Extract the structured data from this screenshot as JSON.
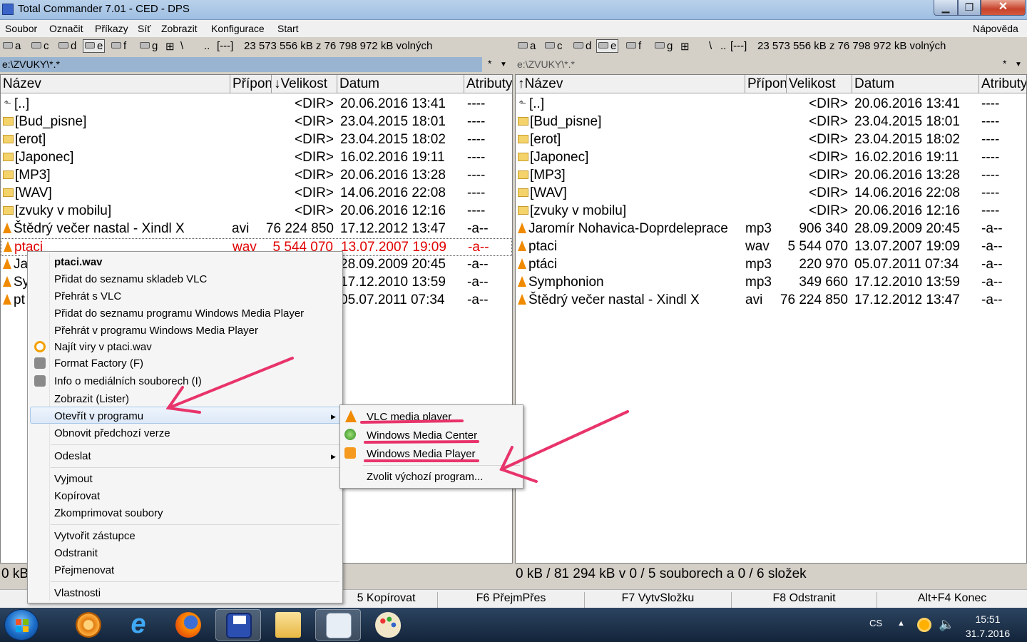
{
  "window": {
    "title": "Total Commander 7.01 - CED - DPS"
  },
  "menu": {
    "items": [
      "Soubor",
      "Označit",
      "Příkazy",
      "Síť",
      "Zobrazit",
      "Konfigurace",
      "Start"
    ],
    "help": "Nápověda"
  },
  "drives": {
    "items": [
      "a",
      "c",
      "d",
      "e",
      "f",
      "g"
    ],
    "root": "\\",
    "up": "..",
    "label": "[---]",
    "free": "23 573 556 kB z 76 798 972 kB volných"
  },
  "left_panel": {
    "path": "e:\\ZVUKY\\*.*",
    "filter": "*",
    "headers": {
      "name": "Název",
      "ext": "Přípon",
      "size": "Velikost",
      "date": "Datum",
      "attr": "Atributy"
    },
    "rows": [
      {
        "name": "[..]",
        "ext": "",
        "size": "<DIR>",
        "date": "20.06.2016 13:41",
        "attr": "----"
      },
      {
        "name": "[Bud_pisne]",
        "ext": "",
        "size": "<DIR>",
        "date": "23.04.2015 18:01",
        "attr": "----"
      },
      {
        "name": "[erot]",
        "ext": "",
        "size": "<DIR>",
        "date": "23.04.2015 18:02",
        "attr": "----"
      },
      {
        "name": "[Japonec]",
        "ext": "",
        "size": "<DIR>",
        "date": "16.02.2016 19:11",
        "attr": "----"
      },
      {
        "name": "[MP3]",
        "ext": "",
        "size": "<DIR>",
        "date": "20.06.2016 13:28",
        "attr": "----"
      },
      {
        "name": "[WAV]",
        "ext": "",
        "size": "<DIR>",
        "date": "14.06.2016 22:08",
        "attr": "----"
      },
      {
        "name": "[zvuky v mobilu]",
        "ext": "",
        "size": "<DIR>",
        "date": "20.06.2016 12:16",
        "attr": "----"
      },
      {
        "name": "Štědrý večer nastal - Xindl X",
        "ext": "avi",
        "size": "76 224 850",
        "date": "17.12.2012 13:47",
        "attr": "-a--"
      },
      {
        "name": "ptaci",
        "ext": "wav",
        "size": "5 544 070",
        "date": "13.07.2007 19:09",
        "attr": "-a--"
      },
      {
        "name": "Ja",
        "ext": "",
        "size": "",
        "date": "28.09.2009 20:45",
        "attr": "-a--"
      },
      {
        "name": "Sy",
        "ext": "",
        "size": "",
        "date": "17.12.2010 13:59",
        "attr": "-a--"
      },
      {
        "name": "pt",
        "ext": "",
        "size": "",
        "date": "05.07.2011 07:34",
        "attr": "-a--"
      }
    ],
    "status": "0 kB"
  },
  "right_panel": {
    "path": "e:\\ZVUKY\\*.*",
    "filter": "*",
    "headers": {
      "name": "Název",
      "ext": "Přípon",
      "size": "Velikost",
      "date": "Datum",
      "attr": "Atributy"
    },
    "rows": [
      {
        "name": "[..]",
        "ext": "",
        "size": "<DIR>",
        "date": "20.06.2016 13:41",
        "attr": "----"
      },
      {
        "name": "[Bud_pisne]",
        "ext": "",
        "size": "<DIR>",
        "date": "23.04.2015 18:01",
        "attr": "----"
      },
      {
        "name": "[erot]",
        "ext": "",
        "size": "<DIR>",
        "date": "23.04.2015 18:02",
        "attr": "----"
      },
      {
        "name": "[Japonec]",
        "ext": "",
        "size": "<DIR>",
        "date": "16.02.2016 19:11",
        "attr": "----"
      },
      {
        "name": "[MP3]",
        "ext": "",
        "size": "<DIR>",
        "date": "20.06.2016 13:28",
        "attr": "----"
      },
      {
        "name": "[WAV]",
        "ext": "",
        "size": "<DIR>",
        "date": "14.06.2016 22:08",
        "attr": "----"
      },
      {
        "name": "[zvuky v mobilu]",
        "ext": "",
        "size": "<DIR>",
        "date": "20.06.2016 12:16",
        "attr": "----"
      },
      {
        "name": "Jaromír Nohavica-Doprdeleprace",
        "ext": "mp3",
        "size": "906 340",
        "date": "28.09.2009 20:45",
        "attr": "-a--"
      },
      {
        "name": "ptaci",
        "ext": "wav",
        "size": "5 544 070",
        "date": "13.07.2007 19:09",
        "attr": "-a--"
      },
      {
        "name": "ptáci",
        "ext": "mp3",
        "size": "220 970",
        "date": "05.07.2011 07:34",
        "attr": "-a--"
      },
      {
        "name": "Symphonion",
        "ext": "mp3",
        "size": "349 660",
        "date": "17.12.2010 13:59",
        "attr": "-a--"
      },
      {
        "name": "Štědrý večer nastal - Xindl X",
        "ext": "avi",
        "size": "76 224 850",
        "date": "17.12.2012 13:47",
        "attr": "-a--"
      }
    ],
    "status": "0 kB / 81 294 kB v 0 / 5 souborech a 0 / 6 složek"
  },
  "fkeys": [
    "5 Kopírovat",
    "F6 PřejmPřes",
    "F7 VytvSložku",
    "F8 Odstranit",
    "Alt+F4 Konec"
  ],
  "context_menu": {
    "title": "ptaci.wav",
    "items": [
      "Přidat do seznamu skladeb VLC",
      "Přehrát s VLC",
      "Přidat do seznamu programu Windows Media Player",
      "Přehrát v programu Windows Media Player",
      "Najít viry v ptaci.wav",
      "Format Factory (F)",
      "Info o mediálních souborech (I)",
      "Zobrazit (Lister)",
      "Otevřít v programu",
      "Obnovit předchozí verze",
      "Odeslat",
      "Vyjmout",
      "Kopírovat",
      "Zkomprimovat soubory",
      "Vytvořit zástupce",
      "Odstranit",
      "Přejmenovat",
      "Vlastnosti"
    ]
  },
  "submenu": {
    "items": [
      "VLC media player",
      "Windows Media Center",
      "Windows Media Player",
      "Zvolit výchozí program..."
    ]
  },
  "tray": {
    "lang": "CS",
    "time": "15:51",
    "date": "31.7.2016"
  },
  "colors": {
    "annotation": "#e8336b",
    "selected_text": "#e00000"
  }
}
